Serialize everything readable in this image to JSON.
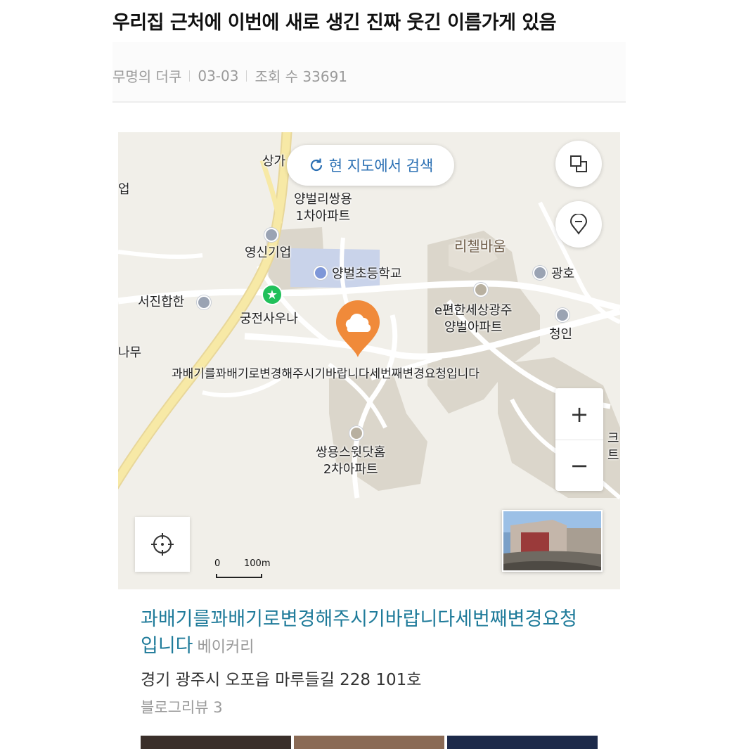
{
  "post": {
    "title": "우리집 근처에 이번에 새로 생긴 진짜 웃긴 이름가게 있음",
    "author": "무명의 더쿠",
    "date": "03-03",
    "views": "조회 수 33691"
  },
  "map": {
    "search_button_label": "현 지도에서 검색",
    "layers_icon": "layers-icon",
    "place_pin_icon": "location-pin-icon",
    "locate_icon": "crosshair-icon",
    "zoom_in_label": "+",
    "zoom_out_label": "−",
    "scale_zero": "0",
    "scale_distance": "100m",
    "labels": {
      "top_cut": "상가",
      "left_edge_1": "업",
      "left_edge_2": "나무",
      "yangbeol_ssangyong": "양벌리쌍용\n1차아파트",
      "youngshin": "영신기업",
      "elementary_school": "양벌초등학교",
      "richelle": "리첼바움",
      "gwangho": "광호",
      "seojin": "서진합한",
      "gungjeon_sauna": "궁전사우나",
      "epyeonhan": "e편한세상광주\n양벌아파트",
      "cheongin": "청인",
      "bakery_on_map": "과배기를꽈배기로변경해주시기바랍니다세번째변경요청입니다",
      "ssangyong_sweet": "쌍용스윗닷홈\n2차아파트",
      "right_edge": "크\n트"
    },
    "colors": {
      "pin": "#f08a3a",
      "school_area": "#c9d3ea",
      "building_area": "#dbd6cb",
      "main_road": "#f7e9a6",
      "road": "#ffffff",
      "poi_green": "#21c05a"
    }
  },
  "place": {
    "name": "과배기를꽈배기로변경해주시기바랍니다세번째변경요청입니다",
    "category": "베이커리",
    "address": "경기 광주시 오포읍 마루들길 228 101호",
    "reviews": "블로그리뷰 3"
  }
}
